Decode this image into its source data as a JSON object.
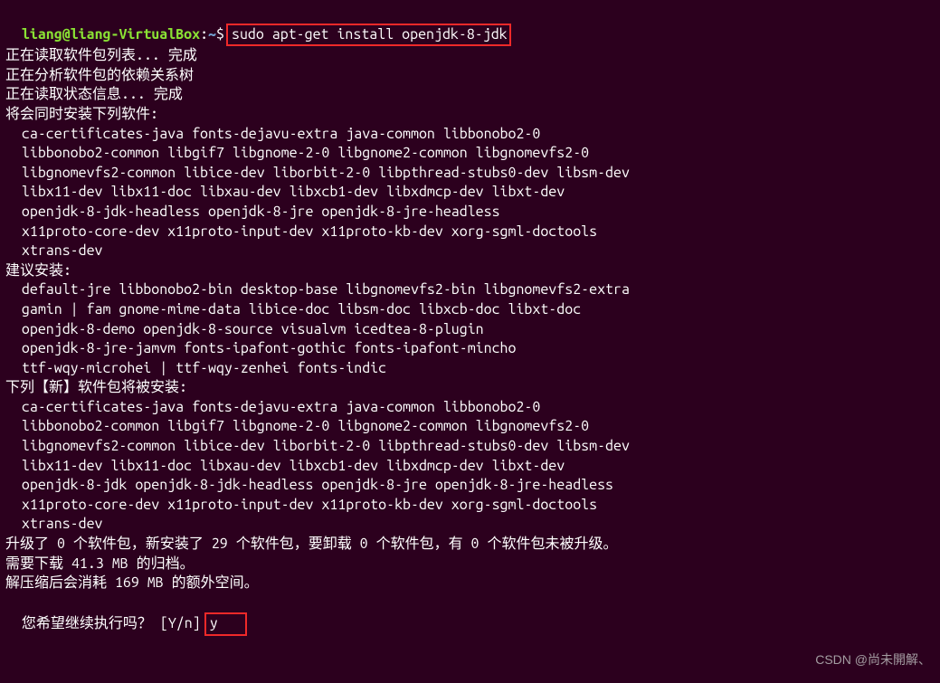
{
  "prompt": {
    "user": "liang",
    "at": "@",
    "host": "liang-VirtualBox",
    "colon": ":",
    "path": "~",
    "dollar": "$",
    "command": "sudo apt-get install openjdk-8-jdk"
  },
  "lines": {
    "l1": "正在读取软件包列表... 完成",
    "l2": "正在分析软件包的依赖关系树",
    "l3": "正在读取状态信息... 完成",
    "l4": "将会同时安装下列软件:",
    "pkg1a": "ca-certificates-java fonts-dejavu-extra java-common libbonobo2-0",
    "pkg1b": "libbonobo2-common libgif7 libgnome-2-0 libgnome2-common libgnomevfs2-0",
    "pkg1c": "libgnomevfs2-common libice-dev liborbit-2-0 libpthread-stubs0-dev libsm-dev",
    "pkg1d": "libx11-dev libx11-doc libxau-dev libxcb1-dev libxdmcp-dev libxt-dev",
    "pkg1e": "openjdk-8-jdk-headless openjdk-8-jre openjdk-8-jre-headless",
    "pkg1f": "x11proto-core-dev x11proto-input-dev x11proto-kb-dev xorg-sgml-doctools",
    "pkg1g": "xtrans-dev",
    "l5": "建议安装:",
    "sug1": "default-jre libbonobo2-bin desktop-base libgnomevfs2-bin libgnomevfs2-extra",
    "sug2": "gamin | fam gnome-mime-data libice-doc libsm-doc libxcb-doc libxt-doc",
    "sug3": "openjdk-8-demo openjdk-8-source visualvm icedtea-8-plugin",
    "sug4": "openjdk-8-jre-jamvm fonts-ipafont-gothic fonts-ipafont-mincho",
    "sug5": "ttf-wqy-microhei | ttf-wqy-zenhei fonts-indic",
    "l6": "下列【新】软件包将被安装:",
    "new1": "ca-certificates-java fonts-dejavu-extra java-common libbonobo2-0",
    "new2": "libbonobo2-common libgif7 libgnome-2-0 libgnome2-common libgnomevfs2-0",
    "new3": "libgnomevfs2-common libice-dev liborbit-2-0 libpthread-stubs0-dev libsm-dev",
    "new4": "libx11-dev libx11-doc libxau-dev libxcb1-dev libxdmcp-dev libxt-dev",
    "new5": "openjdk-8-jdk openjdk-8-jdk-headless openjdk-8-jre openjdk-8-jre-headless",
    "new6": "x11proto-core-dev x11proto-input-dev x11proto-kb-dev xorg-sgml-doctools",
    "new7": "xtrans-dev",
    "l7": "升级了 0 个软件包，新安装了 29 个软件包，要卸载 0 个软件包，有 0 个软件包未被升级。",
    "l8": "需要下载 41.3 MB 的归档。",
    "l9": "解压缩后会消耗 169 MB 的额外空间。",
    "l10": "您希望继续执行吗？ [Y/n]",
    "answer": "y"
  },
  "watermark": "CSDN @尚未開解、"
}
